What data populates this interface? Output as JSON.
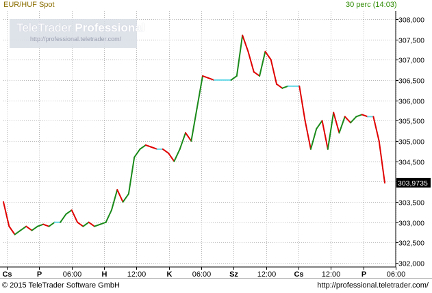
{
  "header": {
    "symbol": "EUR/HUF Spot",
    "interval": "30 perc (14:03)"
  },
  "watermark": {
    "brand_light": "TeleTrader ",
    "brand_bold": "Professional",
    "url": "http://professional.teletrader.com/"
  },
  "footer": {
    "copyright": "© 2015 TeleTrader Software GmbH",
    "url": "http://professional.teletrader.com/"
  },
  "colors": {
    "up": "#1a8a1a",
    "down": "#e00000",
    "flat": "#66d9e8",
    "last_price_bg": "#000000"
  },
  "chart_data": {
    "type": "line",
    "title": "EUR/HUF Spot",
    "ylim": [
      301.9,
      308.2
    ],
    "y_ticks": [
      "302,000",
      "302,500",
      "303,000",
      "303,500",
      "304,000",
      "304,500",
      "305,000",
      "305,500",
      "306,000",
      "306,500",
      "307,000",
      "307,500",
      "308,000"
    ],
    "last_price": "303,9735",
    "x_ticks": [
      {
        "label": "Cs",
        "bold": true
      },
      {
        "label": "P",
        "bold": true
      },
      {
        "label": "06:00",
        "bold": false
      },
      {
        "label": "H",
        "bold": true
      },
      {
        "label": "12:00",
        "bold": false
      },
      {
        "label": "K",
        "bold": true
      },
      {
        "label": "06:00",
        "bold": false
      },
      {
        "label": "Sz",
        "bold": true
      },
      {
        "label": "12:00",
        "bold": false
      },
      {
        "label": "Cs",
        "bold": true
      },
      {
        "label": "12:00",
        "bold": false
      },
      {
        "label": "P",
        "bold": true
      },
      {
        "label": "06:00",
        "bold": false
      }
    ],
    "series": [
      {
        "values": [
          303.5,
          302.9,
          302.7,
          302.8,
          302.9,
          302.8,
          302.9,
          302.95,
          302.9,
          303.0,
          303.0,
          303.2,
          303.3,
          303.0,
          302.9,
          303.0,
          302.9,
          302.95,
          303.0,
          303.3,
          303.8,
          303.5,
          303.7,
          304.6,
          304.8,
          304.9,
          304.85,
          304.8,
          304.8,
          304.7,
          304.5,
          304.8,
          305.2,
          305.0,
          305.8,
          306.6,
          306.55,
          306.5,
          306.5,
          306.5,
          306.5,
          306.6,
          307.6,
          307.2,
          306.7,
          306.6,
          307.2,
          307.0,
          306.4,
          306.3,
          306.35,
          306.35,
          306.35,
          305.5,
          304.8,
          305.3,
          305.5,
          304.8,
          305.7,
          305.2,
          305.6,
          305.45,
          305.6,
          305.65,
          305.6,
          305.6,
          305.0,
          303.97
        ]
      }
    ]
  }
}
